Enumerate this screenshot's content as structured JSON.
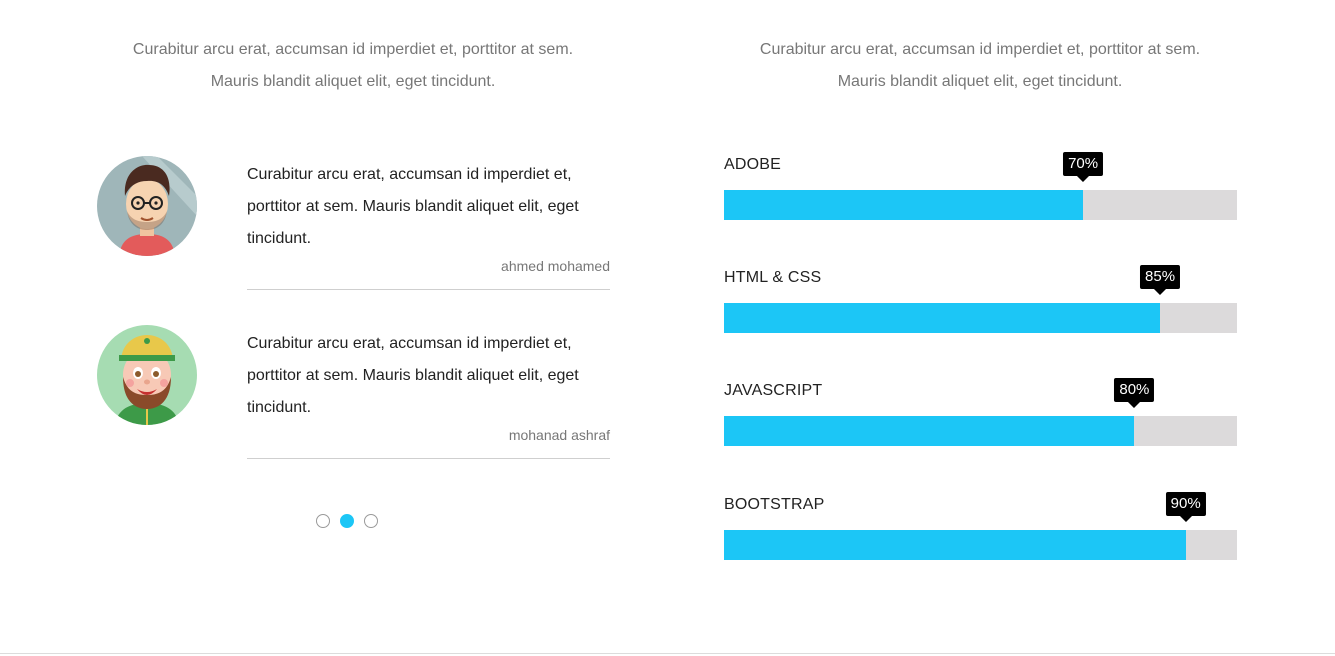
{
  "intro_left": {
    "line1": "Curabitur arcu erat, accumsan id imperdiet et, porttitor at sem.",
    "line2": "Mauris blandit aliquet elit, eget tincidunt."
  },
  "intro_right": {
    "line1": "Curabitur arcu erat, accumsan id imperdiet et, porttitor at sem.",
    "line2": "Mauris blandit aliquet elit, eget tincidunt."
  },
  "testimonials": [
    {
      "quote": "Curabitur arcu erat, accumsan id imperdiet et, porttitor at sem. Mauris blandit aliquet elit, eget tincidunt.",
      "author": "ahmed mohamed",
      "avatar": "man-with-glasses-avatar"
    },
    {
      "quote": "Curabitur arcu erat, accumsan id imperdiet et, porttitor at sem. Mauris blandit aliquet elit, eget tincidunt.",
      "author": "mohanad ashraf",
      "avatar": "bearded-man-with-cap-avatar"
    }
  ],
  "carousel": {
    "dots": 3,
    "active_index": 1
  },
  "skills": [
    {
      "name": "ADOBE",
      "percent": 70,
      "label": "70%"
    },
    {
      "name": "HTML & CSS",
      "percent": 85,
      "label": "85%"
    },
    {
      "name": "JAVASCRIPT",
      "percent": 80,
      "label": "80%"
    },
    {
      "name": "BOOTSTRAP",
      "percent": 90,
      "label": "90%"
    }
  ],
  "colors": {
    "accent": "#1cc6f6",
    "track": "#dcdadb",
    "tooltip": "#000000"
  }
}
